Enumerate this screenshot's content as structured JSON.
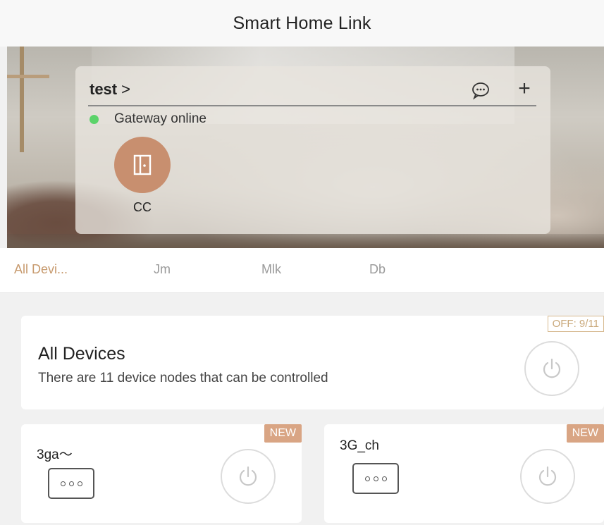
{
  "app": {
    "title": "Smart Home Link"
  },
  "home": {
    "name": "test",
    "chevron": ">",
    "status": "Gateway online",
    "status_color": "#5bd36a",
    "icons": {
      "message": "message-dots-icon",
      "add": "plus-icon"
    },
    "add_glyph": "+",
    "scene": {
      "label": "CC",
      "icon": "door-icon",
      "color": "#c88f6f"
    }
  },
  "tabs": [
    {
      "label": "All Devi...",
      "active": true
    },
    {
      "label": "Jm",
      "active": false
    },
    {
      "label": "Mlk",
      "active": false
    },
    {
      "label": "Db",
      "active": false
    }
  ],
  "all_devices": {
    "title": "All Devices",
    "subtitle": "There are 11 device nodes that can be controlled",
    "badge": "OFF: 9/11",
    "power_icon": "power-icon"
  },
  "devices": [
    {
      "name": "3ga～",
      "badge": "NEW",
      "icon": "node-dots-icon",
      "power_icon": "power-icon"
    },
    {
      "name": "3G_ch",
      "badge": "NEW",
      "icon": "node-dots-icon",
      "power_icon": "power-icon"
    }
  ],
  "colors": {
    "accent": "#c79a6e",
    "badge_new": "#d9a584",
    "tab_inactive": "#9a9a9a"
  }
}
